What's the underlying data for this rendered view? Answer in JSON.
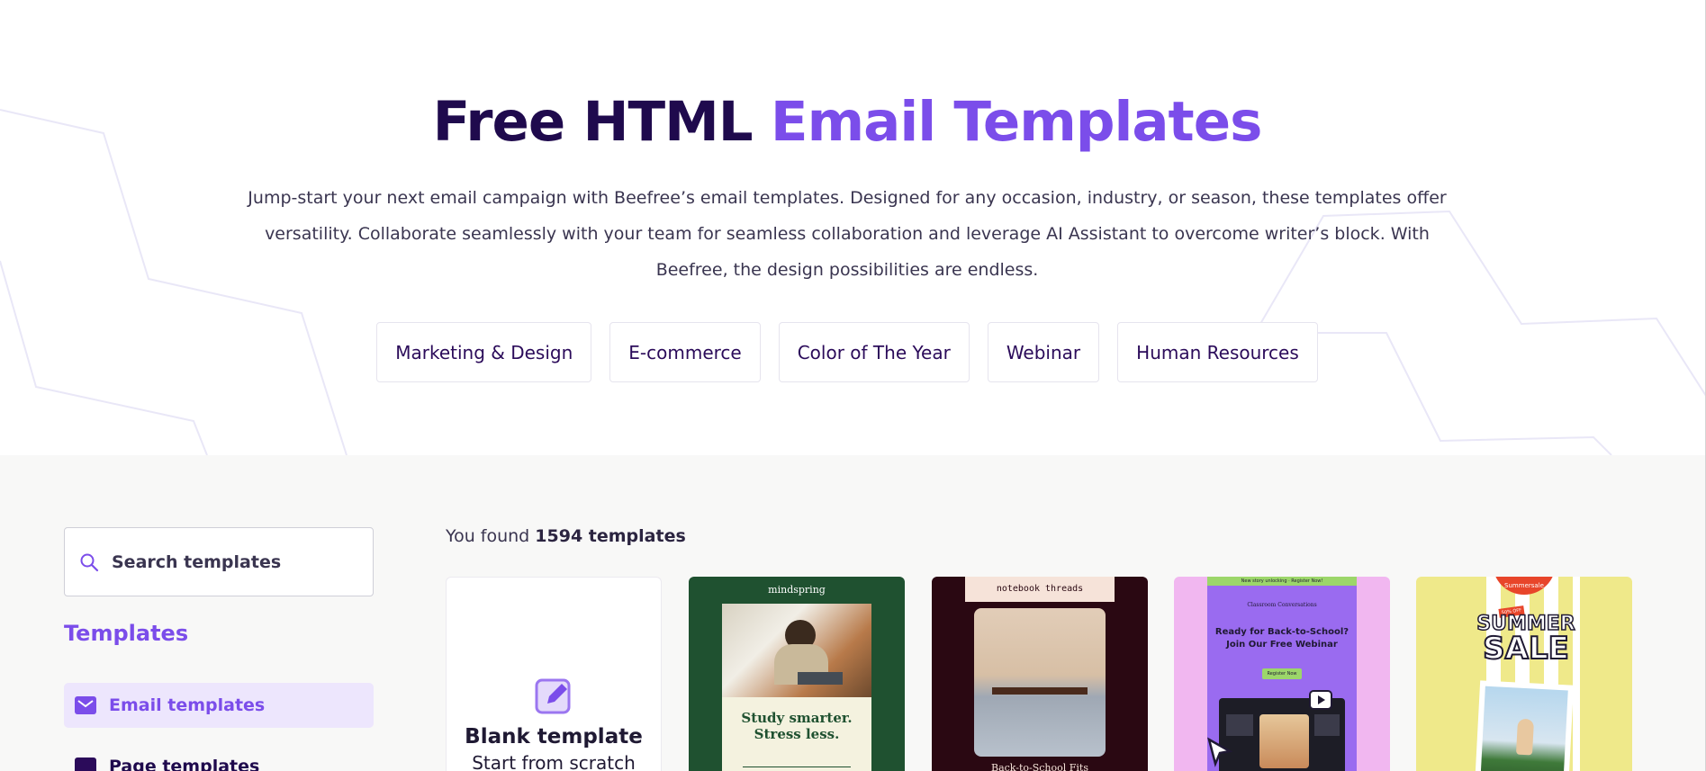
{
  "hero": {
    "title_part1": "Free HTML ",
    "title_part2": "Email Templates",
    "subtitle": "Jump-start your next email campaign with Beefree’s email templates. Designed for any occasion, industry, or season, these templates offer versatility. Collaborate seamlessly with your team for seamless collaboration and leverage AI Assistant to overcome writer’s block. With Beefree, the design possibilities are endless.",
    "categories": [
      "Marketing & Design",
      "E-commerce",
      "Color of The Year",
      "Webinar",
      "Human Resources"
    ]
  },
  "sidebar": {
    "search_placeholder": "Search templates",
    "heading": "Templates",
    "items": [
      {
        "label": "Email templates",
        "icon": "envelope-icon",
        "active": true
      },
      {
        "label": "Page templates",
        "icon": "page-icon",
        "active": false
      }
    ]
  },
  "results": {
    "prefix": "You found ",
    "count": "1594 templates"
  },
  "cards": {
    "blank": {
      "title": "Blank template",
      "subtitle": "Start from scratch"
    },
    "mindspring": {
      "brand": "mindspring",
      "headline1": "Study smarter.",
      "headline2": "Stress less."
    },
    "notebook": {
      "brand": "notebook threads",
      "caption": "Back-to-School Fits"
    },
    "webinar": {
      "topbar": "New story unlocking · Register Now!",
      "brand": "Classroom Conversations",
      "headline1": "Ready for Back-to-School?",
      "headline2": "Join Our Free Webinar",
      "button": "Register Now"
    },
    "summer": {
      "badge": "Summersale",
      "tag": "50% OFF",
      "line1": "SUMMER",
      "line2": "SALE"
    }
  },
  "colors": {
    "accent": "#7b4dea",
    "title_dark": "#1f0a4d",
    "chip_text": "#2b0b5a",
    "lower_bg": "#f8f8f7"
  }
}
